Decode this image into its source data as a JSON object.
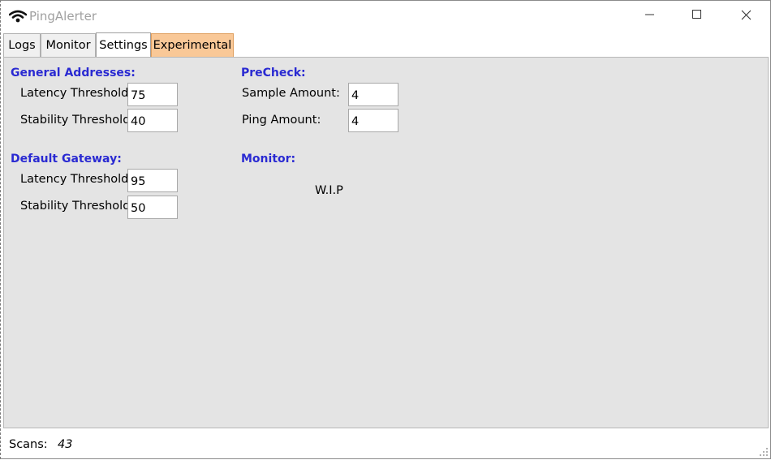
{
  "window": {
    "title": "PingAlerter",
    "app_icon": "wifi-signal-icon",
    "controls": [
      "minimize-icon",
      "maximize-icon",
      "close-icon"
    ]
  },
  "tabs": [
    {
      "label": "Logs",
      "active": false
    },
    {
      "label": "Monitor",
      "active": false
    },
    {
      "label": "Settings",
      "active": true
    },
    {
      "label": "Experimental",
      "active": false,
      "color": "#f9c897"
    }
  ],
  "settings": {
    "general": {
      "title": "General Addresses:",
      "latency_label": "Latency Threshold:",
      "latency_value": "75",
      "stability_label": "Stability Threshold:",
      "stability_value": "40"
    },
    "gateway": {
      "title": "Default Gateway:",
      "latency_label": "Latency Threshold:",
      "latency_value": "95",
      "stability_label": "Stability Threshold:",
      "stability_value": "50"
    },
    "precheck": {
      "title": "PreCheck:",
      "sample_label": "Sample Amount:",
      "sample_value": "4",
      "ping_label": "Ping Amount:",
      "ping_value": "4"
    },
    "monitor": {
      "title": "Monitor:",
      "status": "W.I.P"
    }
  },
  "status": {
    "scans_label": "Scans:",
    "scans_value": "43"
  },
  "colors": {
    "section_title": "#2a2ad2",
    "panel_bg": "#e4e4e4",
    "experimental_tab": "#f9c897"
  }
}
